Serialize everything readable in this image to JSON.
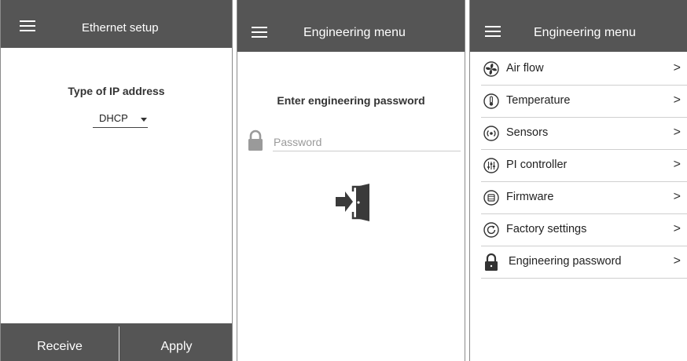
{
  "ethernet": {
    "title": "Ethernet setup",
    "ip_label": "Type of IP address",
    "ip_type_value": "DHCP",
    "receive_label": "Receive",
    "apply_label": "Apply"
  },
  "password_screen": {
    "title": "Engineering menu",
    "prompt": "Enter engineering password",
    "password_placeholder": "Password",
    "password_value": ""
  },
  "engineering_menu": {
    "title": "Engineering menu",
    "chevron": ">",
    "items": [
      {
        "label": "Air flow",
        "icon": "fan-icon"
      },
      {
        "label": "Temperature",
        "icon": "thermometer-icon"
      },
      {
        "label": "Sensors",
        "icon": "sensor-icon"
      },
      {
        "label": "PI controller",
        "icon": "sliders-icon"
      },
      {
        "label": "Firmware",
        "icon": "chip-icon"
      },
      {
        "label": "Factory settings",
        "icon": "reset-icon"
      },
      {
        "label": "Engineering password",
        "icon": "lock-icon"
      }
    ]
  },
  "colors": {
    "topbar": "#555555",
    "divider": "#cfcfcf",
    "text": "#222222"
  }
}
